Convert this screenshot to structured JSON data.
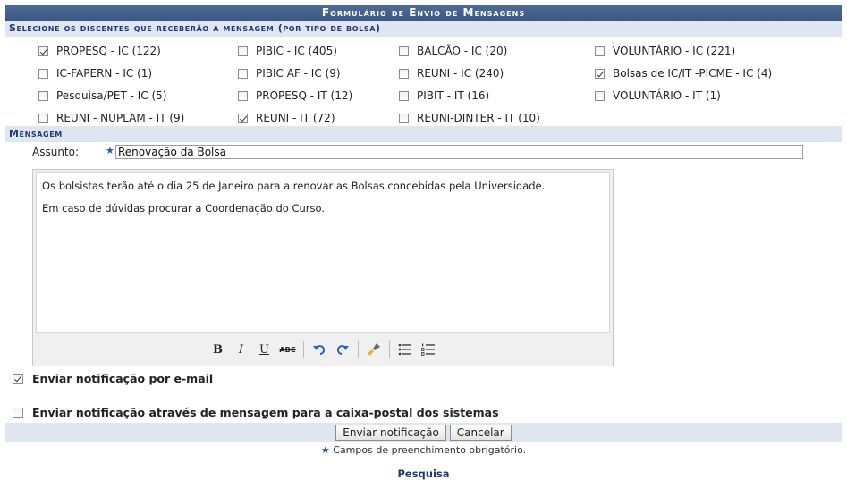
{
  "form": {
    "title": "Formulário de Envio de Mensagens",
    "section_bolsas": "Selecione os discentes que receberão a mensagem (por tipo de bolsa)",
    "section_mensagem": "Mensagem"
  },
  "bolsas": [
    {
      "label": "PROPESQ - IC (122)",
      "checked": true
    },
    {
      "label": "PIBIC - IC (405)",
      "checked": false
    },
    {
      "label": "BALCÃO - IC (20)",
      "checked": false
    },
    {
      "label": "VOLUNTÁRIO - IC (221)",
      "checked": false
    },
    {
      "label": "IC-FAPERN - IC (1)",
      "checked": false
    },
    {
      "label": "PIBIC AF - IC (9)",
      "checked": false
    },
    {
      "label": "REUNI - IC (240)",
      "checked": false
    },
    {
      "label": "Bolsas de IC/IT -PICME - IC (4)",
      "checked": true
    },
    {
      "label": "Pesquisa/PET - IC (5)",
      "checked": false
    },
    {
      "label": "PROPESQ - IT (12)",
      "checked": false
    },
    {
      "label": "PIBIT - IT (16)",
      "checked": false
    },
    {
      "label": "VOLUNTÁRIO - IT (1)",
      "checked": false
    },
    {
      "label": "REUNI - NUPLAM - IT (9)",
      "checked": false
    },
    {
      "label": "REUNI - IT (72)",
      "checked": true
    },
    {
      "label": "REUNI-DINTER - IT (10)",
      "checked": false
    }
  ],
  "mensagem": {
    "assunto_label": "Assunto:",
    "required_mark": "★",
    "assunto_value": "Renovação da Bolsa",
    "body_line1": "Os bolsistas terão até o dia 25 de Janeiro para a renovar as Bolsas concebidas pela Universidade.",
    "body_line2": "Em caso de dúvidas procurar a Coordenação do Curso.",
    "toolbar": {
      "bold": "B",
      "italic": "I",
      "underline": "U",
      "strike": "ABC"
    }
  },
  "notify": {
    "email_label": "Enviar notificação por e-mail",
    "email_checked": true,
    "caixa_label": "Enviar notificação através de mensagem para a caixa-postal dos sistemas",
    "caixa_checked": false
  },
  "buttons": {
    "send": "Enviar notificação",
    "cancel": "Cancelar"
  },
  "required_note": "Campos de preenchimento obrigatório.",
  "bottom_link": "Pesquisa",
  "colors": {
    "header": "#3c5683",
    "section": "#dfe6f2",
    "accent": "#1f3a72",
    "required": "#2a56b5"
  }
}
